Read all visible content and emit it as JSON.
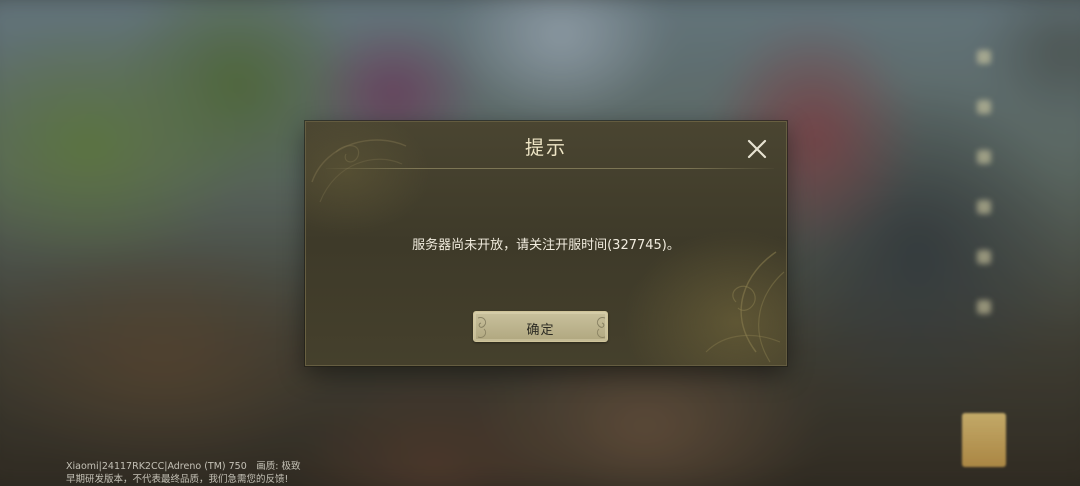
{
  "dialog": {
    "title": "提示",
    "message": "服务器尚未开放，请关注开服时间(327745)。",
    "confirm_label": "确定",
    "close_icon": "close-icon"
  },
  "footer": {
    "device_info": "Xiaomi|24117RK2CC|Adreno (TM) 750　画质: 极致",
    "disclaimer": "早期研发版本，不代表最终品质，我们急需您的反馈!"
  },
  "colors": {
    "dialog_bg": "#3e3a29",
    "title_text": "#efe6c6",
    "button_bg": "#c9c19d",
    "message_text": "#f1ecde"
  }
}
